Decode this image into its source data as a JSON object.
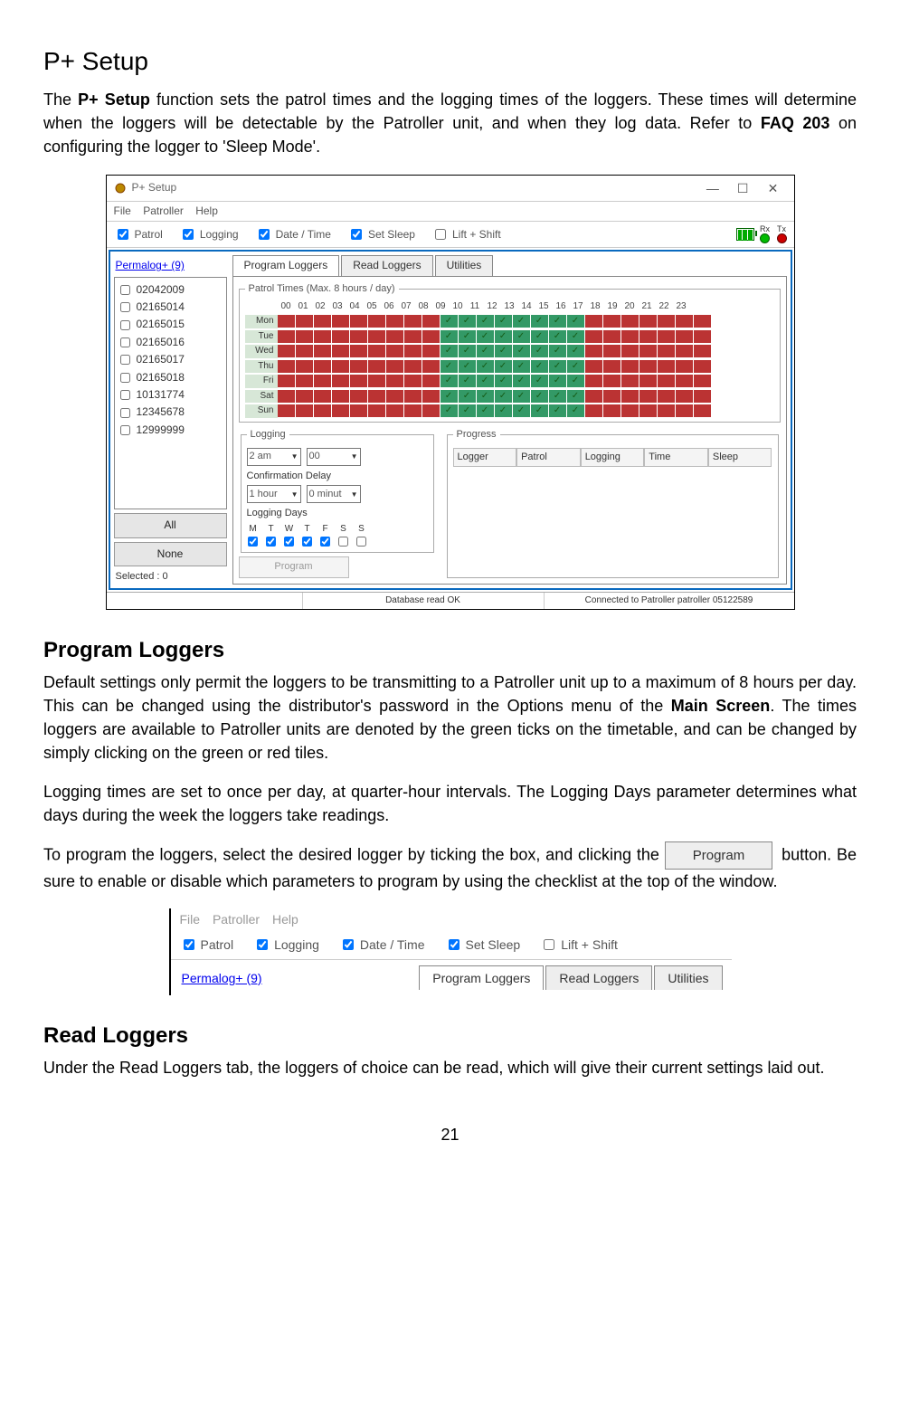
{
  "title": "P+ Setup",
  "intro": {
    "pre": "The ",
    "bold1": "P+ Setup",
    "mid": " function sets the patrol times and the logging times of the loggers. These times will determine when the loggers will be detectable by the Patroller unit, and when they log data. Refer to ",
    "bold2": "FAQ 203",
    "post": " on configuring the logger to 'Sleep Mode'."
  },
  "window": {
    "title": "P+ Setup",
    "menu": [
      "File",
      "Patroller",
      "Help"
    ],
    "controls": {
      "min": "—",
      "max": "☐",
      "close": "✕"
    },
    "rxLabel": "Rx",
    "txLabel": "Tx",
    "toolbar": [
      {
        "label": "Patrol",
        "checked": true
      },
      {
        "label": "Logging",
        "checked": true
      },
      {
        "label": "Date / Time",
        "checked": true
      },
      {
        "label": "Set Sleep",
        "checked": true
      },
      {
        "label": "Lift + Shift",
        "checked": false
      }
    ],
    "permalog": "Permalog+ (9)",
    "loggers": [
      "02042009",
      "02165014",
      "02165015",
      "02165016",
      "02165017",
      "02165018",
      "10131774",
      "12345678",
      "12999999"
    ],
    "allBtn": "All",
    "noneBtn": "None",
    "selected": "Selected : 0",
    "tabs": [
      "Program Loggers",
      "Read Loggers",
      "Utilities"
    ],
    "patrolLegend": "Patrol Times (Max. 8 hours / day)",
    "hours": [
      "00",
      "01",
      "02",
      "03",
      "04",
      "05",
      "06",
      "07",
      "08",
      "09",
      "10",
      "11",
      "12",
      "13",
      "14",
      "15",
      "16",
      "17",
      "18",
      "19",
      "20",
      "21",
      "22",
      "23"
    ],
    "days": [
      "Mon",
      "Tue",
      "Wed",
      "Thu",
      "Fri",
      "Sat",
      "Sun"
    ],
    "onStart": 9,
    "onEnd": 17,
    "logging": {
      "legend": "Logging",
      "hour": "2 am",
      "min": "00",
      "confDelay": "Confirmation Delay",
      "cdHour": "1 hour",
      "cdMin": "0 minut",
      "loggingDays": "Logging Days",
      "dayLetters": [
        "M",
        "T",
        "W",
        "T",
        "F",
        "S",
        "S"
      ],
      "dayChecked": [
        true,
        true,
        true,
        true,
        true,
        false,
        false
      ]
    },
    "progress": {
      "legend": "Progress",
      "cols": [
        "Logger",
        "Patrol",
        "Logging",
        "Time",
        "Sleep"
      ]
    },
    "programBtn": "Program",
    "status": {
      "left": "",
      "mid": "Database read OK",
      "right": "Connected to Patroller patroller 05122589"
    }
  },
  "sections": {
    "programLoggers": {
      "heading": "Program Loggers",
      "p1_pre": "Default settings only permit the loggers to be transmitting to a Patroller unit up to a maximum of 8 hours per day. This can be changed using the distributor's password in the Options menu of the ",
      "p1_bold": "Main Screen",
      "p1_post": ". The times loggers are available to Patroller units are denoted by the green ticks on the timetable, and can be changed by simply clicking on the green or red tiles.",
      "p2": "Logging times are set to once per day, at quarter-hour intervals. The Logging Days parameter determines what days during the week the loggers take readings.",
      "p3_pre": "To program the loggers, select the desired logger by ticking the box, and clicking the ",
      "p3_btn": "Program",
      "p3_post": " button. Be sure to enable or disable which parameters to program by using the checklist at the top of the window."
    },
    "readLoggers": {
      "heading": "Read Loggers",
      "p1": "Under the Read Loggers tab, the loggers of choice can be read, which will give their current settings laid out."
    }
  },
  "pageNum": "21"
}
